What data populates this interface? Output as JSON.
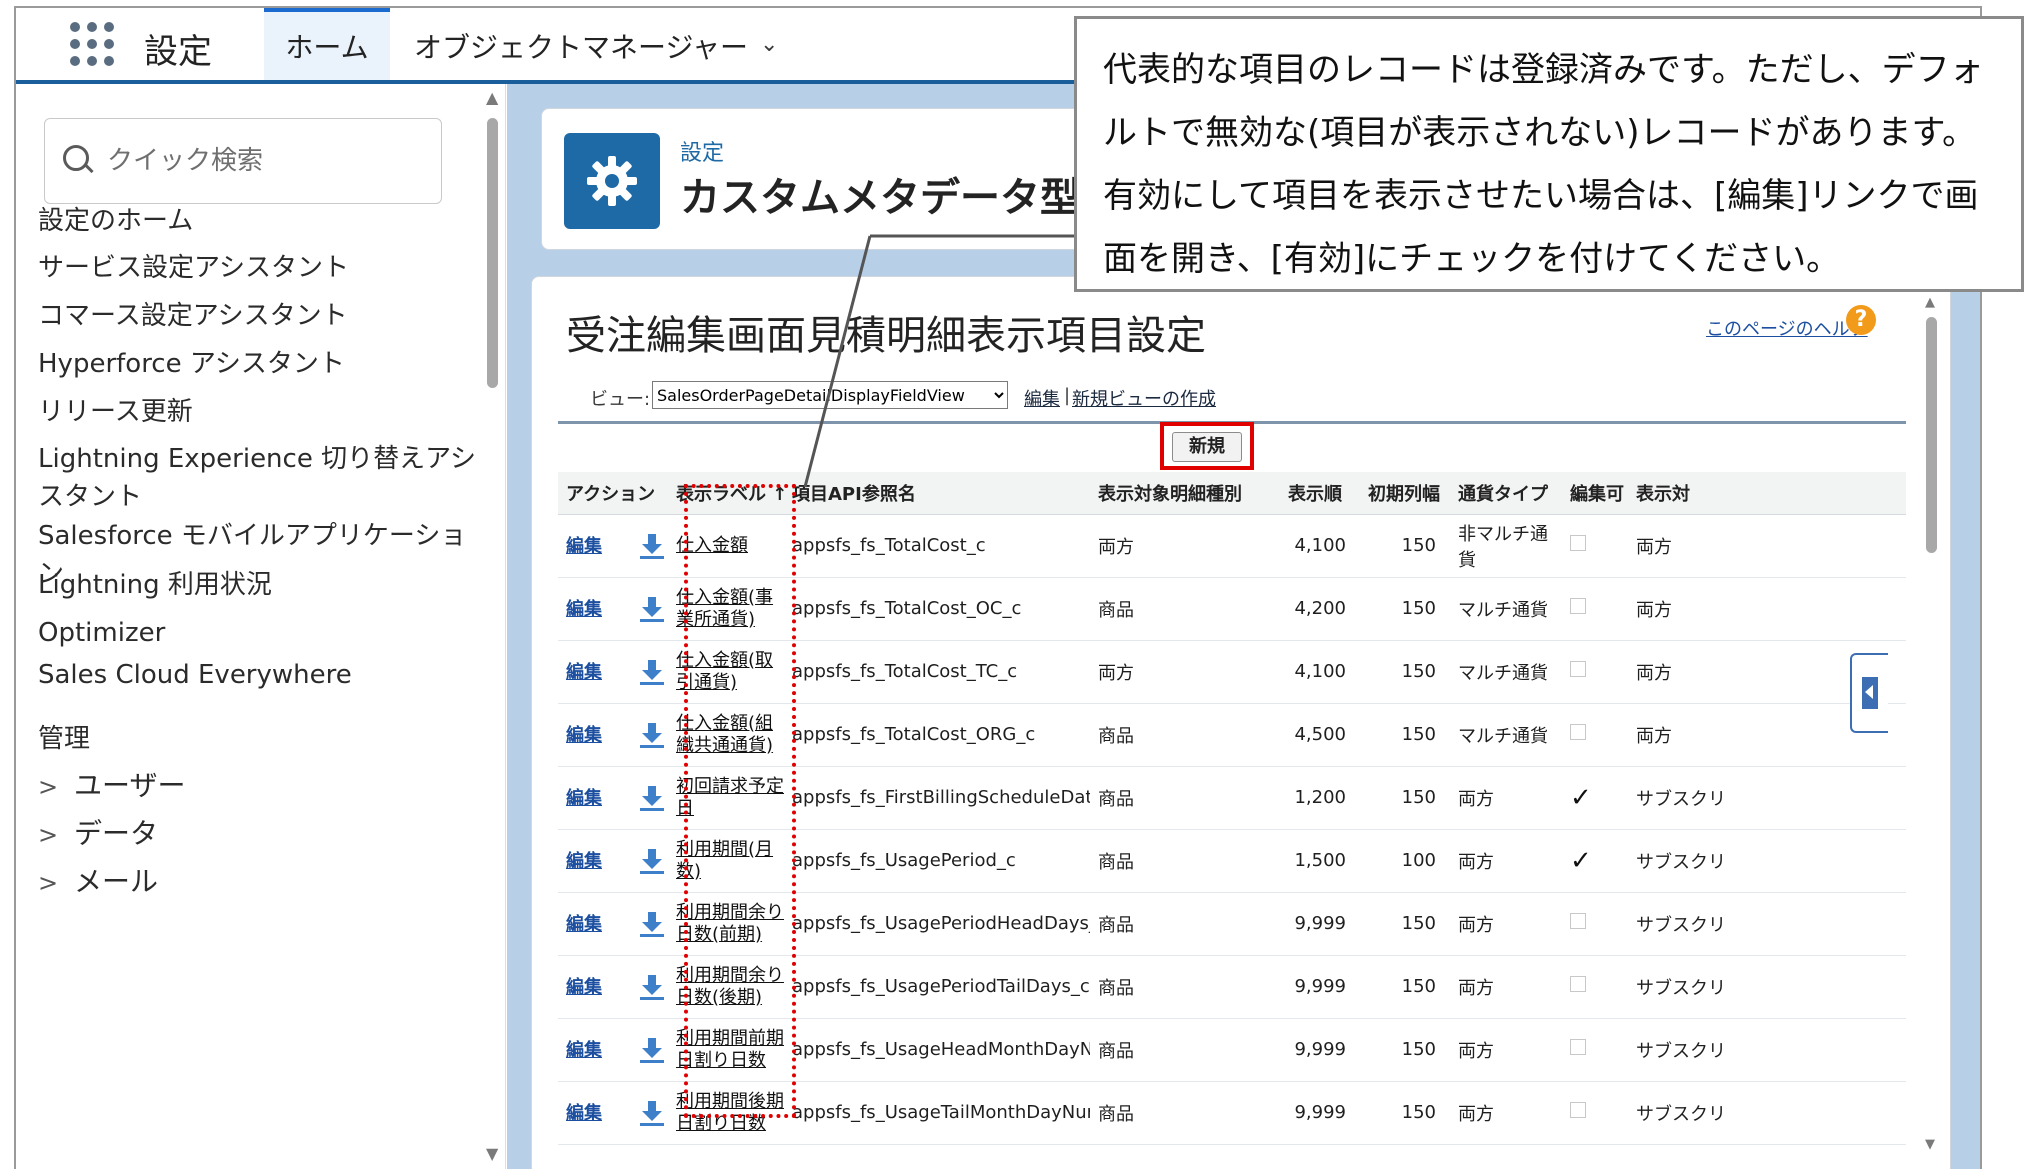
{
  "topbar": {
    "app_name": "設定",
    "tabs": [
      "ホーム",
      "オブジェクトマネージャー"
    ],
    "objmgr_chevron": "⌄"
  },
  "sidebar": {
    "search_placeholder": "クイック検索",
    "items": [
      "設定のホーム",
      "サービス設定アシスタント",
      "コマース設定アシスタント",
      "Hyperforce アシスタント",
      "リリース更新",
      "Lightning Experience 切り替えアシスタント",
      "Salesforce モバイルアプリケーション",
      "Lightning 利用状況",
      "Optimizer",
      "Sales Cloud Everywhere"
    ],
    "group_label": "管理",
    "expandables": [
      "ユーザー",
      "データ",
      "メール"
    ]
  },
  "header": {
    "eyebrow": "設定",
    "title": "カスタムメタデータ型"
  },
  "page": {
    "heading": "受注編集画面見積明細表示項目設定",
    "help_link": "このページのヘルプ",
    "help_icon": "?",
    "view_label": "ビュー:",
    "view_selected": "SalesOrderPageDetailDisplayFieldView",
    "view_edit": "編集",
    "view_sep": "|",
    "view_create": "新規ビューの作成",
    "new_button": "新規"
  },
  "table": {
    "columns": [
      "アクション",
      "表示ラベル ↑",
      "項目API参照名",
      "表示対象明細種別",
      "表示順",
      "初期列幅",
      "通貨タイプ",
      "編集可",
      "表示対"
    ],
    "rows": [
      {
        "action": "編集",
        "label": "仕入金額",
        "api": "appsfs_fs_TotalCost_c",
        "target": "両方",
        "order": "4,100",
        "width": "150",
        "currency": "非マルチ通貨",
        "editable": false,
        "display": "両方"
      },
      {
        "action": "編集",
        "label": "仕入金額(事業所通貨)",
        "api": "appsfs_fs_TotalCost_OC_c",
        "target": "商品",
        "order": "4,200",
        "width": "150",
        "currency": "マルチ通貨",
        "editable": false,
        "display": "両方"
      },
      {
        "action": "編集",
        "label": "仕入金額(取引通貨)",
        "api": "appsfs_fs_TotalCost_TC_c",
        "target": "両方",
        "order": "4,100",
        "width": "150",
        "currency": "マルチ通貨",
        "editable": false,
        "display": "両方"
      },
      {
        "action": "編集",
        "label": "仕入金額(組織共通通貨)",
        "api": "appsfs_fs_TotalCost_ORG_c",
        "target": "商品",
        "order": "4,500",
        "width": "150",
        "currency": "マルチ通貨",
        "editable": false,
        "display": "両方"
      },
      {
        "action": "編集",
        "label": "初回請求予定日",
        "api": "appsfs_fs_FirstBillingScheduleDate_c",
        "target": "商品",
        "order": "1,200",
        "width": "150",
        "currency": "両方",
        "editable": true,
        "display": "サブスクリ"
      },
      {
        "action": "編集",
        "label": "利用期間(月数)",
        "api": "appsfs_fs_UsagePeriod_c",
        "target": "商品",
        "order": "1,500",
        "width": "100",
        "currency": "両方",
        "editable": true,
        "display": "サブスクリ"
      },
      {
        "action": "編集",
        "label": "利用期間余り日数(前期)",
        "api": "appsfs_fs_UsagePeriodHeadDays_c",
        "target": "商品",
        "order": "9,999",
        "width": "150",
        "currency": "両方",
        "editable": false,
        "display": "サブスクリ"
      },
      {
        "action": "編集",
        "label": "利用期間余り日数(後期)",
        "api": "appsfs_fs_UsagePeriodTailDays_c",
        "target": "商品",
        "order": "9,999",
        "width": "150",
        "currency": "両方",
        "editable": false,
        "display": "サブスクリ"
      },
      {
        "action": "編集",
        "label": "利用期間前期日割り日数",
        "api": "appsfs_fs_UsageHeadMonthDayNum_c",
        "target": "商品",
        "order": "9,999",
        "width": "150",
        "currency": "両方",
        "editable": false,
        "display": "サブスクリ"
      },
      {
        "action": "編集",
        "label": "利用期間後期日割り日数",
        "api": "appsfs_fs_UsageTailMonthDayNum_c",
        "target": "商品",
        "order": "9,999",
        "width": "150",
        "currency": "両方",
        "editable": false,
        "display": "サブスクリ"
      }
    ]
  },
  "callout": {
    "text": "代表的な項目のレコードは登録済みです。ただし、デフォルトで無効な(項目が表示されない)レコードがあります。有効にして項目を表示させたい場合は、[編集]リンクで画面を開き、[有効]にチェックを付けてください。"
  },
  "colors": {
    "header_blue": "#1b5e9c",
    "content_bg": "#b8cfe8",
    "highlight_red": "#e00000",
    "gear_tile": "#1e6aa6"
  }
}
